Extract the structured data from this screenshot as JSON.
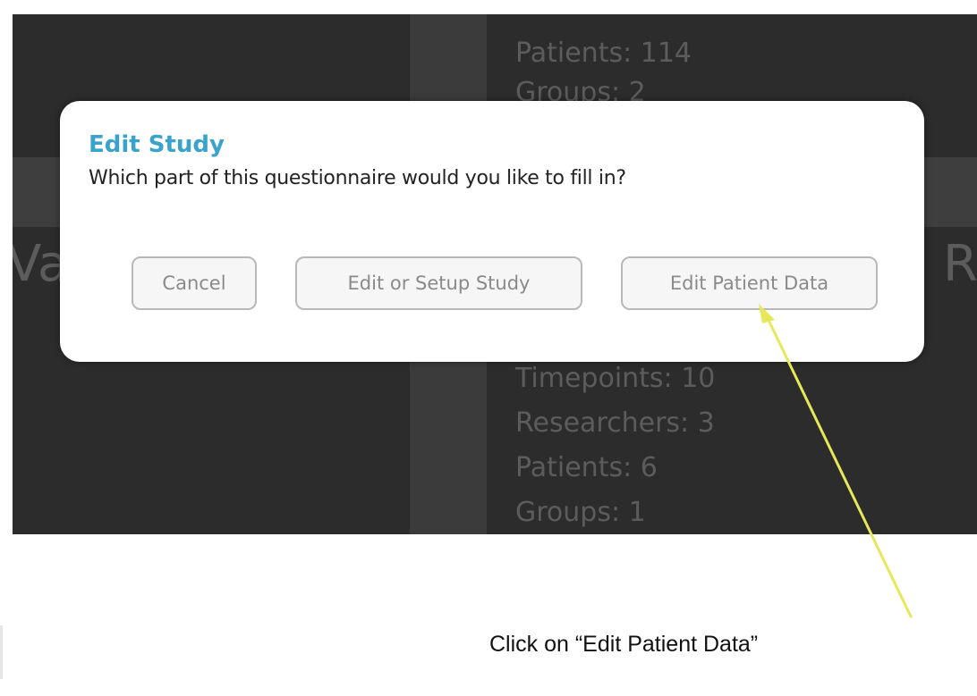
{
  "background": {
    "study_card_top": {
      "patients": "Patients: 114",
      "groups": "Groups: 2"
    },
    "study_card_bottom": {
      "timepoints": "Timepoints: 10",
      "researchers": "Researchers: 3",
      "patients": "Patients: 6",
      "groups": "Groups: 1"
    },
    "left_fragment": "Va",
    "right_fragment": "R"
  },
  "dialog": {
    "title": "Edit Study",
    "message": "Which part of this questionnaire would you like to fill in?",
    "buttons": {
      "cancel": "Cancel",
      "edit_setup": "Edit or Setup Study",
      "edit_patient": "Edit Patient Data"
    }
  },
  "annotation": {
    "text": "Click on “Edit Patient Data”",
    "arrow_color": "#e6e85a"
  },
  "colors": {
    "title_accent": "#3aa3cc",
    "app_background": "#2c2c2c",
    "background_text": "#5c5c5c"
  },
  "icons": {
    "annotation_arrow": "arrow-icon"
  }
}
